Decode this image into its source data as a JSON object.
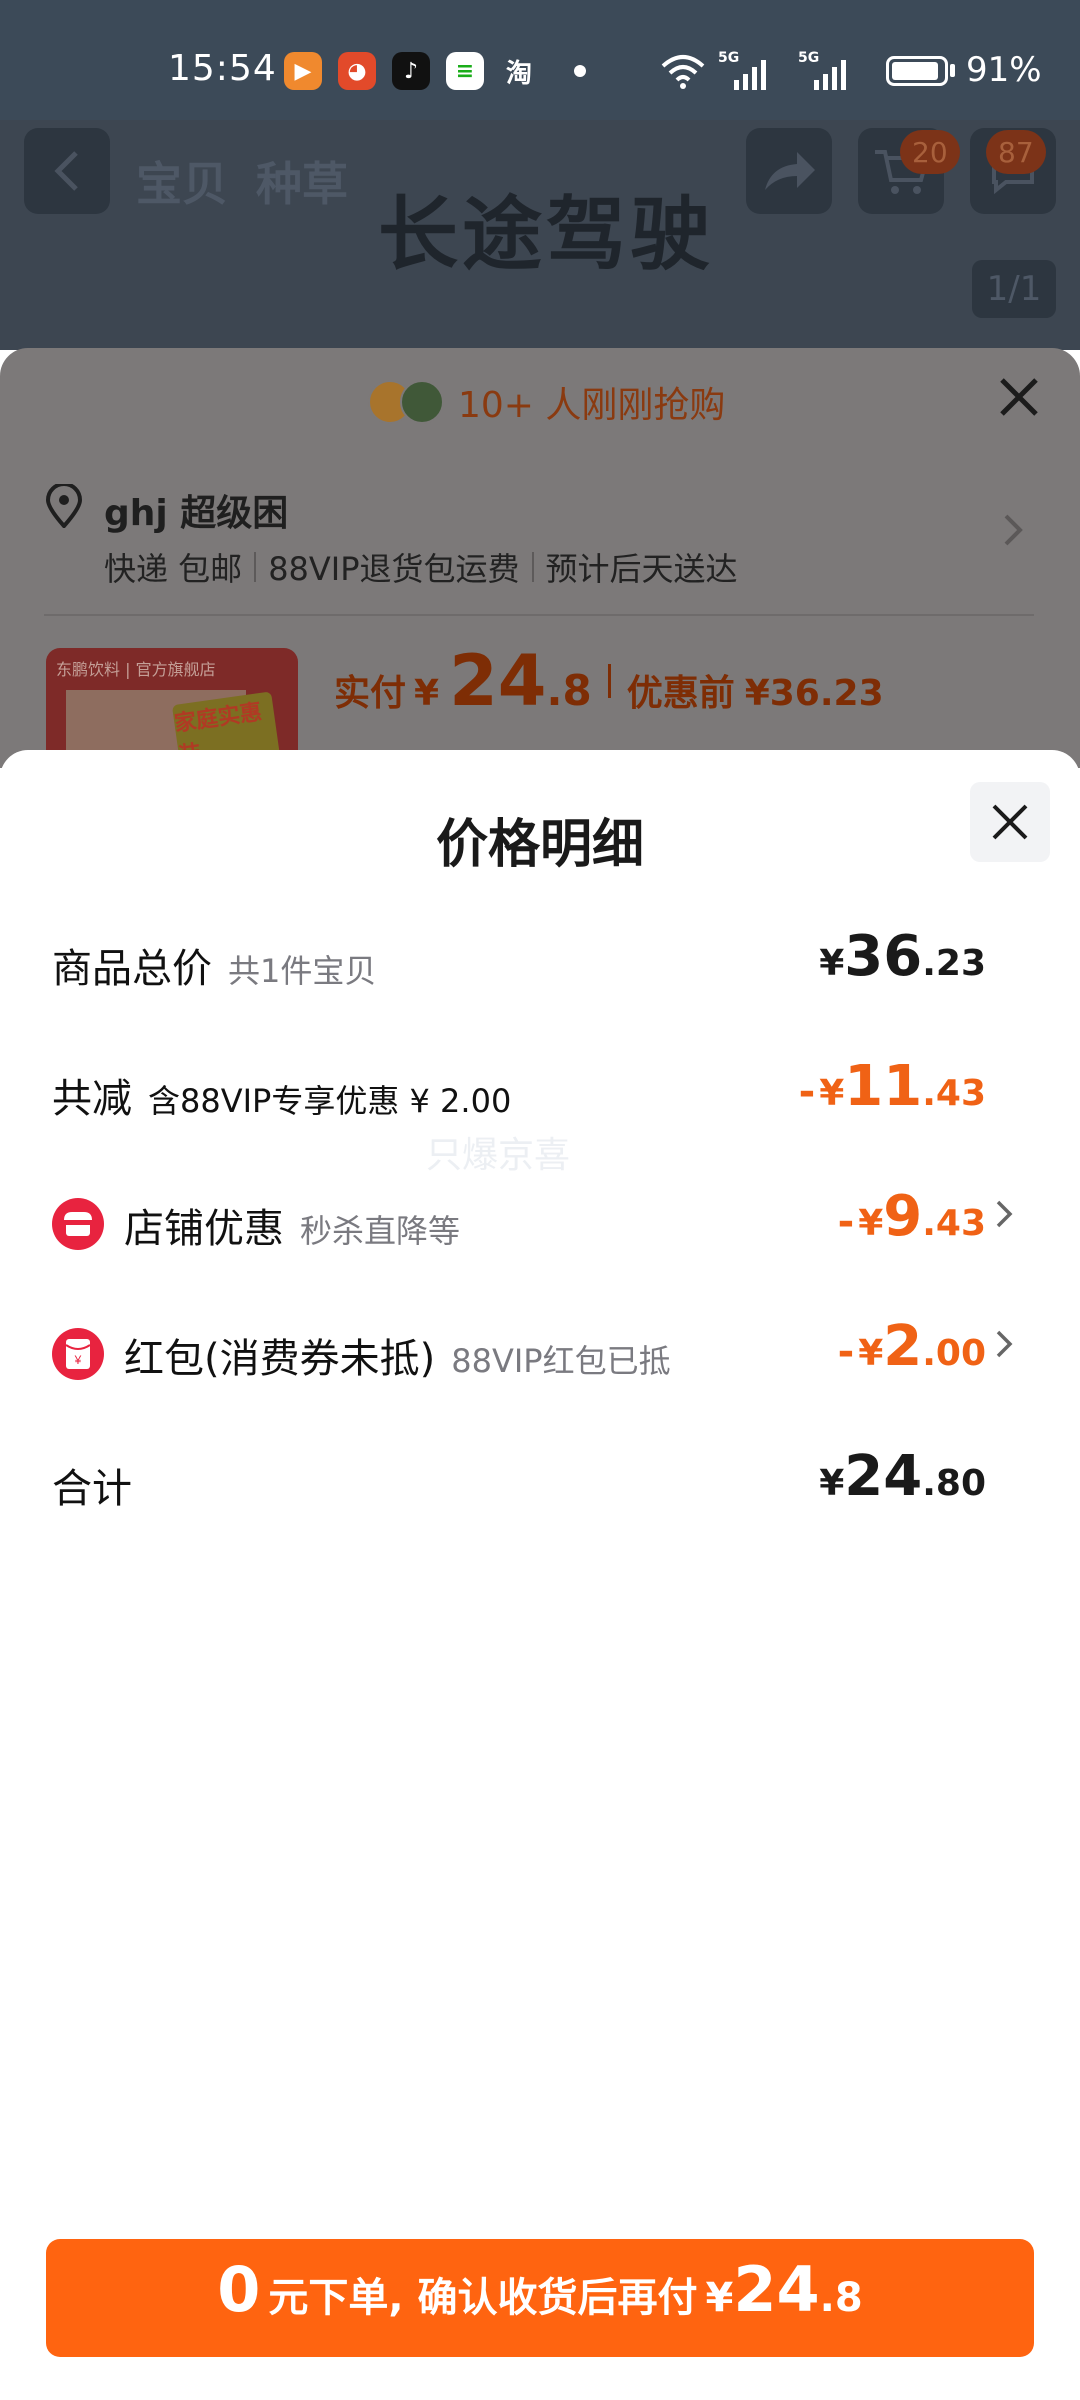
{
  "status_bar": {
    "time": "15:54",
    "carrier_icons": [
      "taobao-live-icon",
      "xianyu-icon",
      "douyin-icon",
      "wechat-pay-icon",
      "taobao-icon"
    ],
    "taobao_glyph": "淘",
    "signal1_label": "5G",
    "signal2_label": "5G",
    "battery_percent": "91%",
    "battery_level": 0.91
  },
  "background_page": {
    "tabs": [
      "宝贝",
      "种草"
    ],
    "title": "长途驾驶",
    "cart_badge": "20",
    "message_badge": "87",
    "page_indicator": "1/1",
    "buyers_text": "10+ 人刚刚抢购",
    "address": {
      "name": "ghj 超级困",
      "delivery": "快递 包邮",
      "return_policy": "88VIP退货包运费",
      "eta": "预计后天送达"
    },
    "product_store_label": "东鹏饮料 | 官方旗舰店",
    "product_tag": "家庭实惠装",
    "pay": {
      "label": "实付",
      "yen": "¥",
      "int": "24",
      "dec": ".8",
      "before_label": "优惠前",
      "before_amount": "¥36.23"
    }
  },
  "sheet": {
    "title": "价格明细",
    "watermark": "只爆京喜",
    "rows": [
      {
        "label": "商品总价",
        "sub": "共1件宝贝",
        "minus": "",
        "yen": "¥",
        "int": "36",
        "dec": ".23"
      },
      {
        "label": "共减",
        "sub": "含88VIP专享优惠 ¥ 2.00",
        "minus": "-",
        "yen": "¥",
        "int": "11",
        "dec": ".43"
      },
      {
        "label": "店铺优惠",
        "sub": "秒杀直降等",
        "minus": "-",
        "yen": "¥",
        "int": "9",
        "dec": ".43"
      },
      {
        "label": "红包(消费券未抵)",
        "sub": "88VIP红包已抵",
        "minus": "-",
        "yen": "¥",
        "int": "2",
        "dec": ".00"
      },
      {
        "label": "合计",
        "sub": "",
        "minus": "",
        "yen": "¥",
        "int": "24",
        "dec": ".80"
      }
    ],
    "pay_button": {
      "big": "0",
      "text": "元下单, 确认收货后再付",
      "yen": "¥",
      "int": "24",
      "dec": ".8"
    }
  },
  "colors": {
    "accent": "#ff6410",
    "discount": "#f06215",
    "coupon_red": "#e8233f"
  }
}
